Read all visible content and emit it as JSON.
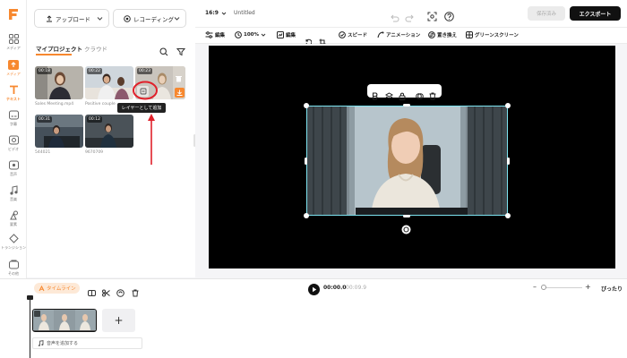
{
  "rail": {
    "items": [
      {
        "label": "メディア",
        "icon": "grid-icon"
      },
      {
        "label": "メディア",
        "icon": "upload-folder-icon"
      },
      {
        "label": "テキスト",
        "icon": "text-icon"
      },
      {
        "label": "字幕",
        "icon": "subtitle-icon"
      },
      {
        "label": "ビデオ",
        "icon": "video-icon"
      },
      {
        "label": "音声",
        "icon": "audio-icon"
      },
      {
        "label": "音楽",
        "icon": "music-icon"
      },
      {
        "label": "要素",
        "icon": "elements-icon"
      },
      {
        "label": "トランジション",
        "icon": "transition-icon"
      },
      {
        "label": "その他",
        "icon": "more-icon"
      }
    ]
  },
  "panel": {
    "upload_label": "アップロード",
    "record_label": "レコーディング",
    "tabs": [
      "マイプロジェクト",
      "クラウド"
    ],
    "tooltip": "レイヤーとして追加",
    "media": [
      {
        "duration": "00:18",
        "caption": "Sales Meeting.mp4"
      },
      {
        "duration": "00:22",
        "caption": "Positive couple"
      },
      {
        "duration": "00:23",
        "caption": ""
      },
      {
        "duration": "00:31",
        "caption": "544021"
      },
      {
        "duration": "00:12",
        "caption": "9670709"
      }
    ]
  },
  "topbar": {
    "aspect": "16:9",
    "title": "Untitled",
    "save_label": "保存済み",
    "export_label": "エクスポート"
  },
  "editbar": {
    "items": [
      "編集",
      "100%",
      "編集",
      "スピード",
      "アニメーション",
      "置き換え",
      "グリーンスクリーン"
    ]
  },
  "timeline": {
    "label": "タイムライン",
    "time_current": "00:00.0",
    "time_total": "00:09.9",
    "fit_label": "ぴったり",
    "add_audio_label": "音声を追加する"
  },
  "colors": {
    "accent": "#f7882f",
    "canvas": "#000000",
    "selection": "#7de3f0",
    "annotation": "#e0202a"
  }
}
